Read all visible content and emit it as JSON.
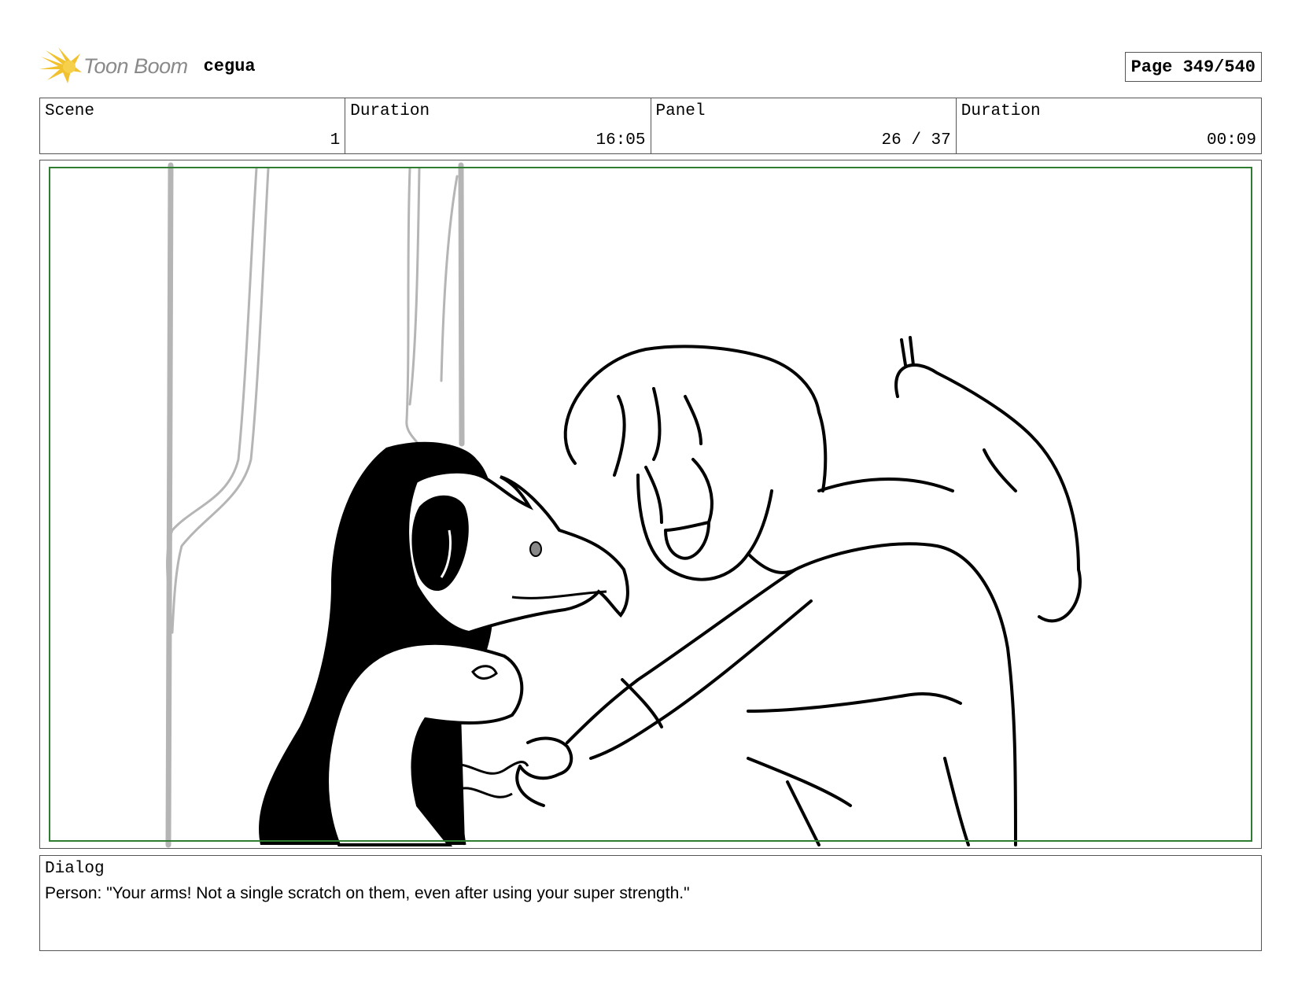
{
  "header": {
    "logo_text": "Toon Boom",
    "logo_icon": "toon-boom-star-icon",
    "project_name": "cegua",
    "page_label": "Page 349/540"
  },
  "info": {
    "scene_label": "Scene",
    "scene_value": "1",
    "scene_duration_label": "Duration",
    "scene_duration_value": "16:05",
    "panel_label": "Panel",
    "panel_value": "26 / 37",
    "panel_duration_label": "Duration",
    "panel_duration_value": "00:09"
  },
  "dialog": {
    "label": "Dialog",
    "text": "Person: \"Your arms! Not a single scratch on them, even after using your super strength.\""
  },
  "colors": {
    "safe_area_border": "#2f7d32",
    "logo_yellow": "#f2c12e",
    "logo_gray": "#8a8a8a"
  }
}
